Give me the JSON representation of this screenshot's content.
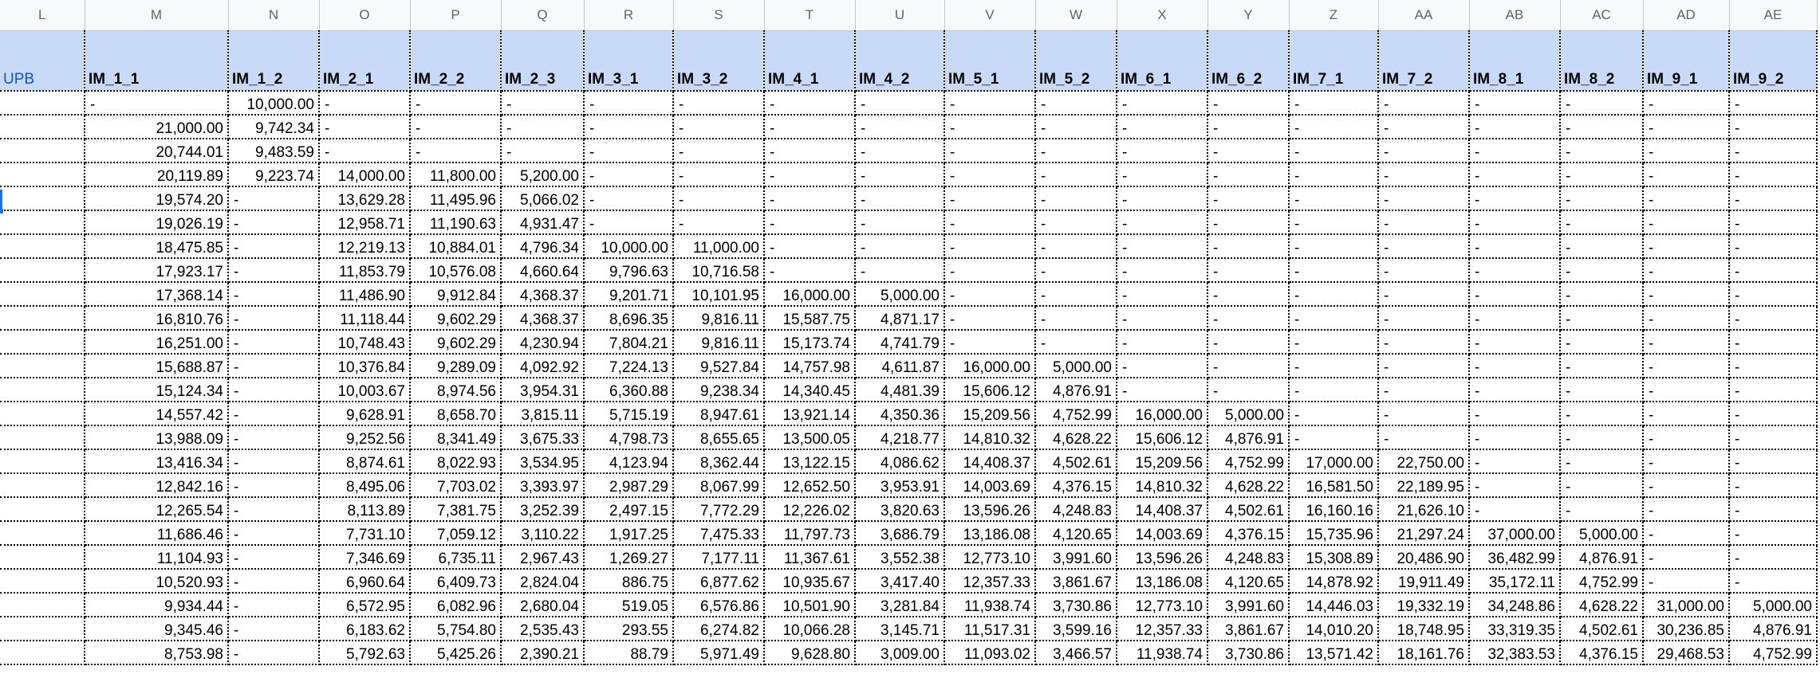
{
  "columns": [
    "L",
    "M",
    "N",
    "O",
    "P",
    "Q",
    "R",
    "S",
    "T",
    "U",
    "V",
    "W",
    "X",
    "Y",
    "Z",
    "AA",
    "AB",
    "AC",
    "AD",
    "AE"
  ],
  "headers": [
    "UPB",
    "IM_1_1",
    "IM_1_2",
    "IM_2_1",
    "IM_2_2",
    "IM_2_3",
    "IM_3_1",
    "IM_3_2",
    "IM_4_1",
    "IM_4_2",
    "IM_5_1",
    "IM_5_2",
    "IM_6_1",
    "IM_6_2",
    "IM_7_1",
    "IM_7_2",
    "IM_8_1",
    "IM_8_2",
    "IM_9_1",
    "IM_9_2"
  ],
  "rows": [
    [
      "",
      "-",
      "10,000.00",
      "-",
      "-",
      "-",
      "-",
      "-",
      "-",
      "-",
      "-",
      "-",
      "-",
      "-",
      "-",
      "-",
      "-",
      "-",
      "-",
      "-"
    ],
    [
      "",
      "21,000.00",
      "9,742.34",
      "-",
      "-",
      "-",
      "-",
      "-",
      "-",
      "-",
      "-",
      "-",
      "-",
      "-",
      "-",
      "-",
      "-",
      "-",
      "-",
      "-"
    ],
    [
      "",
      "20,744.01",
      "9,483.59",
      "-",
      "-",
      "-",
      "-",
      "-",
      "-",
      "-",
      "-",
      "-",
      "-",
      "-",
      "-",
      "-",
      "-",
      "-",
      "-",
      "-"
    ],
    [
      "",
      "20,119.89",
      "9,223.74",
      "14,000.00",
      "11,800.00",
      "5,200.00",
      "-",
      "-",
      "-",
      "-",
      "-",
      "-",
      "-",
      "-",
      "-",
      "-",
      "-",
      "-",
      "-",
      "-"
    ],
    [
      "",
      "19,574.20",
      "-",
      "13,629.28",
      "11,495.96",
      "5,066.02",
      "-",
      "-",
      "-",
      "-",
      "-",
      "-",
      "-",
      "-",
      "-",
      "-",
      "-",
      "-",
      "-",
      "-"
    ],
    [
      "",
      "19,026.19",
      "-",
      "12,958.71",
      "11,190.63",
      "4,931.47",
      "-",
      "-",
      "-",
      "-",
      "-",
      "-",
      "-",
      "-",
      "-",
      "-",
      "-",
      "-",
      "-",
      "-"
    ],
    [
      "",
      "18,475.85",
      "-",
      "12,219.13",
      "10,884.01",
      "4,796.34",
      "10,000.00",
      "11,000.00",
      "-",
      "-",
      "-",
      "-",
      "-",
      "-",
      "-",
      "-",
      "-",
      "-",
      "-",
      "-"
    ],
    [
      "",
      "17,923.17",
      "-",
      "11,853.79",
      "10,576.08",
      "4,660.64",
      "9,796.63",
      "10,716.58",
      "-",
      "-",
      "-",
      "-",
      "-",
      "-",
      "-",
      "-",
      "-",
      "-",
      "-",
      "-"
    ],
    [
      "",
      "17,368.14",
      "-",
      "11,486.90",
      "9,912.84",
      "4,368.37",
      "9,201.71",
      "10,101.95",
      "16,000.00",
      "5,000.00",
      "-",
      "-",
      "-",
      "-",
      "-",
      "-",
      "-",
      "-",
      "-",
      "-"
    ],
    [
      "",
      "16,810.76",
      "-",
      "11,118.44",
      "9,602.29",
      "4,368.37",
      "8,696.35",
      "9,816.11",
      "15,587.75",
      "4,871.17",
      "-",
      "-",
      "-",
      "-",
      "-",
      "-",
      "-",
      "-",
      "-",
      "-"
    ],
    [
      "",
      "16,251.00",
      "-",
      "10,748.43",
      "9,602.29",
      "4,230.94",
      "7,804.21",
      "9,816.11",
      "15,173.74",
      "4,741.79",
      "-",
      "-",
      "-",
      "-",
      "-",
      "-",
      "-",
      "-",
      "-",
      "-"
    ],
    [
      "",
      "15,688.87",
      "-",
      "10,376.84",
      "9,289.09",
      "4,092.92",
      "7,224.13",
      "9,527.84",
      "14,757.98",
      "4,611.87",
      "16,000.00",
      "5,000.00",
      "-",
      "-",
      "-",
      "-",
      "-",
      "-",
      "-",
      "-"
    ],
    [
      "",
      "15,124.34",
      "-",
      "10,003.67",
      "8,974.56",
      "3,954.31",
      "6,360.88",
      "9,238.34",
      "14,340.45",
      "4,481.39",
      "15,606.12",
      "4,876.91",
      "-",
      "-",
      "-",
      "-",
      "-",
      "-",
      "-",
      "-"
    ],
    [
      "",
      "14,557.42",
      "-",
      "9,628.91",
      "8,658.70",
      "3,815.11",
      "5,715.19",
      "8,947.61",
      "13,921.14",
      "4,350.36",
      "15,209.56",
      "4,752.99",
      "16,000.00",
      "5,000.00",
      "-",
      "-",
      "-",
      "-",
      "-",
      "-"
    ],
    [
      "",
      "13,988.09",
      "-",
      "9,252.56",
      "8,341.49",
      "3,675.33",
      "4,798.73",
      "8,655.65",
      "13,500.05",
      "4,218.77",
      "14,810.32",
      "4,628.22",
      "15,606.12",
      "4,876.91",
      "-",
      "-",
      "-",
      "-",
      "-",
      "-"
    ],
    [
      "",
      "13,416.34",
      "-",
      "8,874.61",
      "8,022.93",
      "3,534.95",
      "4,123.94",
      "8,362.44",
      "13,122.15",
      "4,086.62",
      "14,408.37",
      "4,502.61",
      "15,209.56",
      "4,752.99",
      "17,000.00",
      "22,750.00",
      "-",
      "-",
      "-",
      "-"
    ],
    [
      "",
      "12,842.16",
      "-",
      "8,495.06",
      "7,703.02",
      "3,393.97",
      "2,987.29",
      "8,067.99",
      "12,652.50",
      "3,953.91",
      "14,003.69",
      "4,376.15",
      "14,810.32",
      "4,628.22",
      "16,581.50",
      "22,189.95",
      "-",
      "-",
      "-",
      "-"
    ],
    [
      "",
      "12,265.54",
      "-",
      "8,113.89",
      "7,381.75",
      "3,252.39",
      "2,497.15",
      "7,772.29",
      "12,226.02",
      "3,820.63",
      "13,596.26",
      "4,248.83",
      "14,408.37",
      "4,502.61",
      "16,160.16",
      "21,626.10",
      "-",
      "-",
      "-",
      "-"
    ],
    [
      "",
      "11,686.46",
      "-",
      "7,731.10",
      "7,059.12",
      "3,110.22",
      "1,917.25",
      "7,475.33",
      "11,797.73",
      "3,686.79",
      "13,186.08",
      "4,120.65",
      "14,003.69",
      "4,376.15",
      "15,735.96",
      "21,297.24",
      "37,000.00",
      "5,000.00",
      "-",
      "-"
    ],
    [
      "",
      "11,104.93",
      "-",
      "7,346.69",
      "6,735.11",
      "2,967.43",
      "1,269.27",
      "7,177.11",
      "11,367.61",
      "3,552.38",
      "12,773.10",
      "3,991.60",
      "13,596.26",
      "4,248.83",
      "15,308.89",
      "20,486.90",
      "36,482.99",
      "4,876.91",
      "-",
      "-"
    ],
    [
      "",
      "10,520.93",
      "-",
      "6,960.64",
      "6,409.73",
      "2,824.04",
      "886.75",
      "6,877.62",
      "10,935.67",
      "3,417.40",
      "12,357.33",
      "3,861.67",
      "13,186.08",
      "4,120.65",
      "14,878.92",
      "19,911.49",
      "35,172.11",
      "4,752.99",
      "-",
      "-"
    ],
    [
      "",
      "9,934.44",
      "-",
      "6,572.95",
      "6,082.96",
      "2,680.04",
      "519.05",
      "6,576.86",
      "10,501.90",
      "3,281.84",
      "11,938.74",
      "3,730.86",
      "12,773.10",
      "3,991.60",
      "14,446.03",
      "19,332.19",
      "34,248.86",
      "4,628.22",
      "31,000.00",
      "5,000.00"
    ],
    [
      "",
      "9,345.46",
      "-",
      "6,183.62",
      "5,754.80",
      "2,535.43",
      "293.55",
      "6,274.82",
      "10,066.28",
      "3,145.71",
      "11,517.31",
      "3,599.16",
      "12,357.33",
      "3,861.67",
      "14,010.20",
      "18,748.95",
      "33,319.35",
      "4,502.61",
      "30,236.85",
      "4,876.91"
    ],
    [
      "",
      "8,753.98",
      "-",
      "5,792.63",
      "5,425.26",
      "2,390.21",
      "88.79",
      "5,971.49",
      "9,628.80",
      "3,009.00",
      "11,093.02",
      "3,466.57",
      "11,938.74",
      "3,730.86",
      "13,571.42",
      "18,161.76",
      "32,383.53",
      "4,376.15",
      "29,468.53",
      "4,752.99"
    ]
  ]
}
